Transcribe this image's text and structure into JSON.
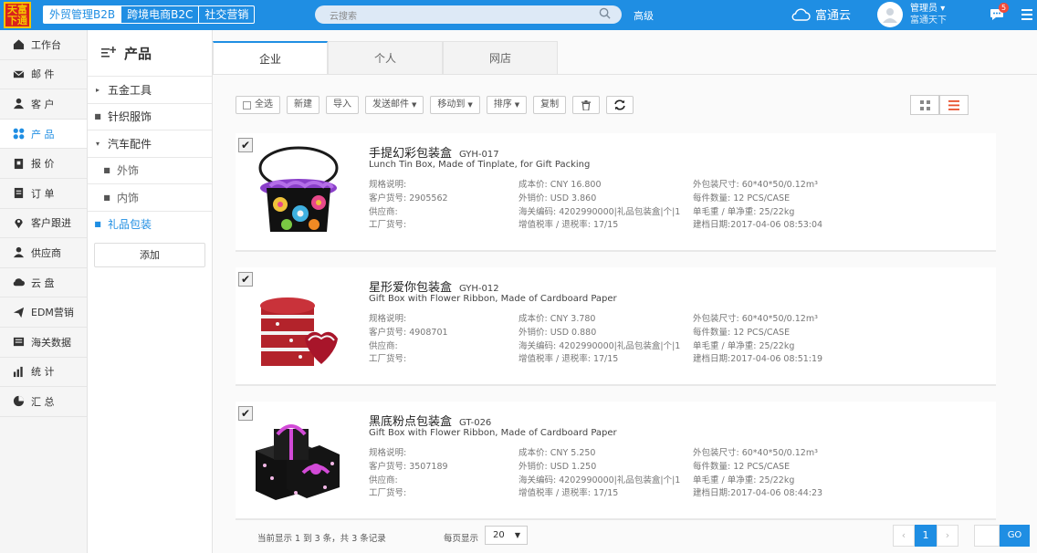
{
  "app": {
    "logo_text": "天富下通",
    "nav_tabs": [
      "外贸管理B2B",
      "跨境电商B2C",
      "社交营销"
    ],
    "search_placeholder": "云搜索",
    "advanced_label": "高级",
    "cloud_label": "富通云",
    "user_name": "管理员",
    "user_company": "富通天下",
    "notification_count": "5"
  },
  "sidebar": {
    "items": [
      {
        "label": "工作台",
        "icon": "home-icon"
      },
      {
        "label": "邮  件",
        "icon": "mail-icon"
      },
      {
        "label": "客  户",
        "icon": "user-icon"
      },
      {
        "label": "产  品",
        "icon": "product-icon"
      },
      {
        "label": "报  价",
        "icon": "quote-icon"
      },
      {
        "label": "订  单",
        "icon": "order-icon"
      },
      {
        "label": "客户跟进",
        "icon": "location-icon"
      },
      {
        "label": "供应商",
        "icon": "supplier-icon"
      },
      {
        "label": "云  盘",
        "icon": "cloud-disk-icon"
      },
      {
        "label": "EDM营销",
        "icon": "send-icon"
      },
      {
        "label": "海关数据",
        "icon": "customs-icon"
      },
      {
        "label": "统  计",
        "icon": "chart-icon"
      },
      {
        "label": "汇  总",
        "icon": "pie-icon"
      }
    ],
    "active_index": 3
  },
  "categories": {
    "title": "产品",
    "rows": [
      {
        "label": "五金工具",
        "marker": "▸",
        "level": 0
      },
      {
        "label": "针织服饰",
        "marker": "■",
        "level": 0
      },
      {
        "label": "汽车配件",
        "marker": "▾",
        "level": 0
      },
      {
        "label": "外饰",
        "marker": "■",
        "level": 1
      },
      {
        "label": "内饰",
        "marker": "■",
        "level": 1
      },
      {
        "label": "礼品包装",
        "marker": "■",
        "level": 0,
        "active": true
      }
    ],
    "add_label": "添加"
  },
  "tabs": [
    "企业",
    "个人",
    "网店"
  ],
  "toolbar": {
    "select_all": "全选",
    "new": "新建",
    "import": "导入",
    "send_mail": "发送邮件",
    "move_to": "移动到",
    "sort": "排序",
    "copy": "复制"
  },
  "products": [
    {
      "name": "手提幻彩包装盒",
      "code": "GYH-017",
      "en": "Lunch Tin Box, Made of Tinplate, for Gift Packing",
      "spec": "规格说明:",
      "cust_no": "客户货号: 2905562",
      "supplier": "供应商:",
      "factory_no": "工厂货号:",
      "cost": "成本价: CNY 16.800",
      "sale": "外销价: USD 3.860",
      "hs": "海关编码: 4202990000|礼品包装盒|个|1",
      "tax": "增值税率 / 退税率: 17/15",
      "pack_size": "外包装尺寸: 60*40*50/0.12m³",
      "qty": "每件数量: 12 PCS/CASE",
      "weight": "单毛重 / 单净重: 25/22kg",
      "date": "建档日期:2017-04-06 08:53:04"
    },
    {
      "name": "星形爱你包装盒",
      "code": "GYH-012",
      "en": "Gift Box with Flower Ribbon, Made of Cardboard Paper",
      "spec": "规格说明:",
      "cust_no": "客户货号: 4908701",
      "supplier": "供应商:",
      "factory_no": "工厂货号:",
      "cost": "成本价: CNY 3.780",
      "sale": "外销价: USD 0.880",
      "hs": "海关编码: 4202990000|礼品包装盒|个|1",
      "tax": "增值税率 / 退税率: 17/15",
      "pack_size": "外包装尺寸: 60*40*50/0.12m³",
      "qty": "每件数量: 12 PCS/CASE",
      "weight": "单毛重 / 单净重: 25/22kg",
      "date": "建档日期:2017-04-06 08:51:19"
    },
    {
      "name": "黑底粉点包装盒",
      "code": "GT-026",
      "en": "Gift Box with Flower Ribbon, Made of Cardboard Paper",
      "spec": "规格说明:",
      "cust_no": "客户货号: 3507189",
      "supplier": "供应商:",
      "factory_no": "工厂货号:",
      "cost": "成本价: CNY 5.250",
      "sale": "外销价: USD 1.250",
      "hs": "海关编码: 4202990000|礼品包装盒|个|1",
      "tax": "增值税率 / 退税率: 17/15",
      "pack_size": "外包装尺寸: 60*40*50/0.12m³",
      "qty": "每件数量: 12 PCS/CASE",
      "weight": "单毛重 / 单净重: 25/22kg",
      "date": "建档日期:2017-04-06 08:44:23"
    }
  ],
  "footer": {
    "info": "当前显示 1 到 3 条，共 3 条记录",
    "per_page_label": "每页显示",
    "per_page_value": "20",
    "current_page": "1",
    "go_label": "GO"
  },
  "colors": {
    "accent": "#1f8ee3",
    "badge": "#f04b3a"
  }
}
